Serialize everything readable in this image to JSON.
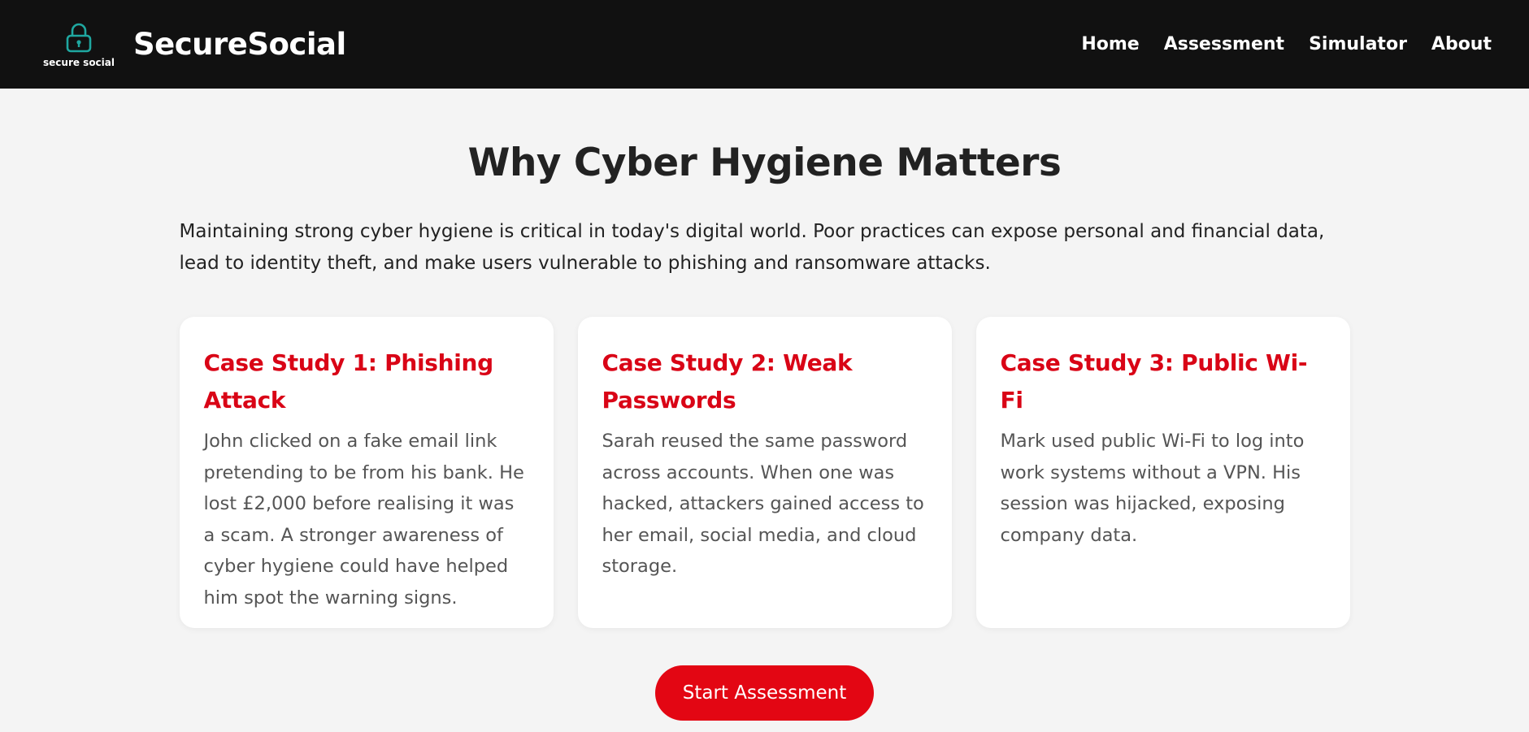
{
  "colors": {
    "header_bg": "#111111",
    "page_bg": "#f4f4f4",
    "accent": "#e30613",
    "card_title": "#d90416",
    "logo_teal": "#1fa7a0"
  },
  "header": {
    "logo_icon": "padlock-icon",
    "logo_text": "secure social",
    "brand": "SecureSocial",
    "nav": [
      {
        "label": "Home"
      },
      {
        "label": "Assessment"
      },
      {
        "label": "Simulator"
      },
      {
        "label": "About"
      }
    ]
  },
  "main": {
    "title": "Why Cyber Hygiene Matters",
    "intro": "Maintaining strong cyber hygiene is critical in today's digital world. Poor practices can expose personal and financial data, lead to identity theft, and make users vulnerable to phishing and ransomware attacks.",
    "cards": [
      {
        "title": "Case Study 1: Phishing Attack",
        "body": "John clicked on a fake email link pretending to be from his bank. He lost £2,000 before realising it was a scam. A stronger awareness of cyber hygiene could have helped him spot the warning signs."
      },
      {
        "title": "Case Study 2: Weak Passwords",
        "body": "Sarah reused the same password across accounts. When one was hacked, attackers gained access to her email, social media, and cloud storage."
      },
      {
        "title": "Case Study 3: Public Wi-Fi",
        "body": "Mark used public Wi-Fi to log into work systems without a VPN. His session was hijacked, exposing company data."
      }
    ],
    "cta_label": "Start Assessment"
  }
}
